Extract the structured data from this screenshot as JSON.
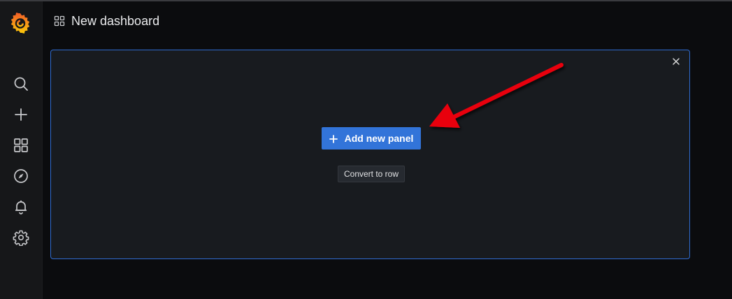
{
  "app": {
    "logo_icon": "grafana-logo-icon",
    "brand_color": "#f46800"
  },
  "sidebar": {
    "items": [
      {
        "icon": "search-icon"
      },
      {
        "icon": "plus-icon"
      },
      {
        "icon": "dashboards-icon"
      },
      {
        "icon": "compass-icon"
      },
      {
        "icon": "bell-icon"
      },
      {
        "icon": "gear-icon"
      }
    ]
  },
  "header": {
    "icon": "dashboards-icon",
    "title": "New dashboard"
  },
  "panel": {
    "add_button_label": "Add new panel",
    "convert_button_label": "Convert to row",
    "close_icon": "close-icon",
    "accent_color": "#3274d9",
    "border_color": "#2f6bd0"
  },
  "annotation": {
    "arrow_color": "#e8000b"
  }
}
